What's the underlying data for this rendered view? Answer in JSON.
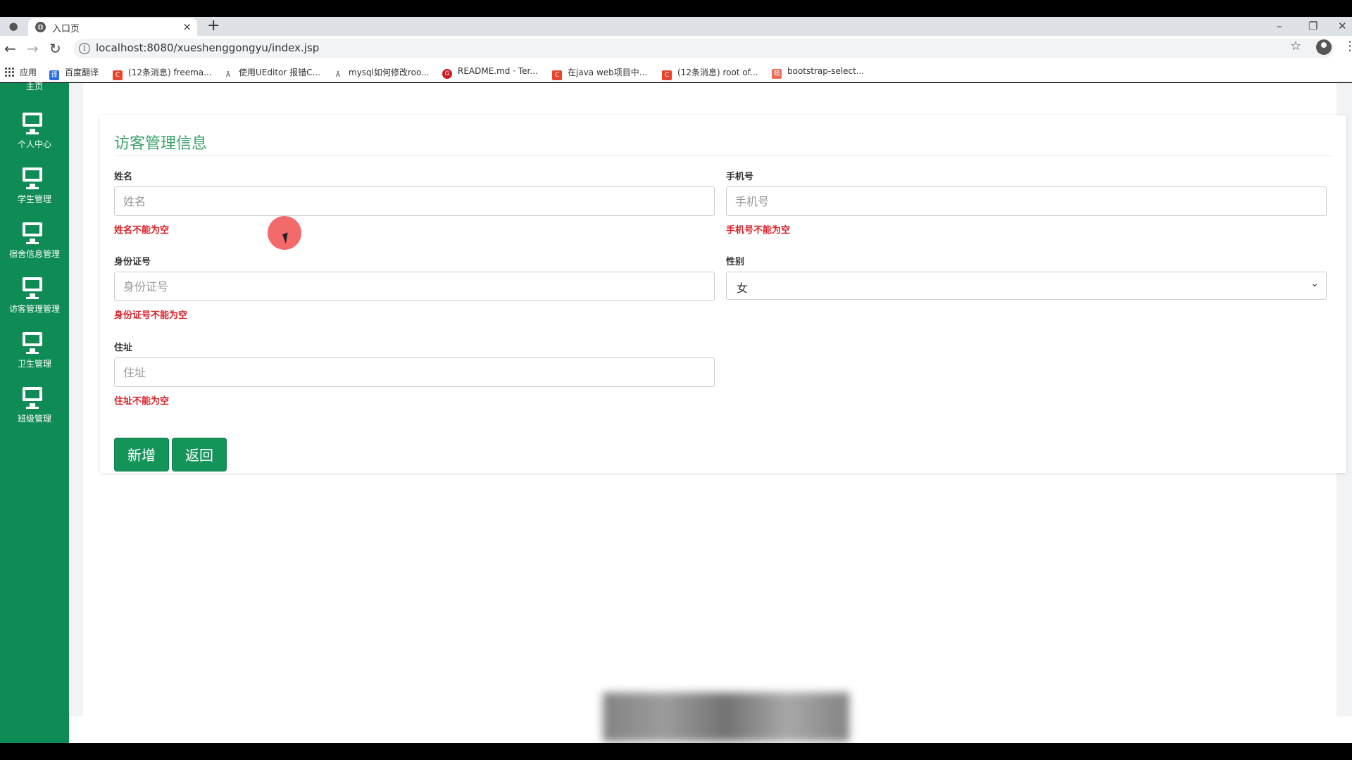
{
  "browser": {
    "tab_title": "入口页",
    "tab_close": "×",
    "new_tab": "+",
    "url": "localhost:8080/xueshenggongyu/index.jsp",
    "minimize": "–",
    "restore": "❐",
    "close": "✕"
  },
  "bookmarks": [
    {
      "label": "应用",
      "icon": "apps-grid"
    },
    {
      "label": "百度翻译",
      "icon": "translate",
      "color": "#2b6de5"
    },
    {
      "label": "(12条消息) freema...",
      "icon": "csdn",
      "color": "#e8452c"
    },
    {
      "label": "使用UEditor 报错C...",
      "icon": "a-icon"
    },
    {
      "label": "mysql如何修改roo...",
      "icon": "a-icon"
    },
    {
      "label": "README.md · Ter...",
      "icon": "gitee",
      "color": "#c71d23"
    },
    {
      "label": "在java web项目中...",
      "icon": "csdn",
      "color": "#e8452c"
    },
    {
      "label": "(12条消息) root of...",
      "icon": "csdn",
      "color": "#e8452c"
    },
    {
      "label": "bootstrap-select...",
      "icon": "jianshu",
      "color": "#ea6f5a"
    }
  ],
  "sidebar": {
    "partial_label": "主页",
    "items": [
      {
        "label": "个人中心"
      },
      {
        "label": "学生管理"
      },
      {
        "label": "宿舍信息管理"
      },
      {
        "label": "访客管理管理"
      },
      {
        "label": "卫生管理"
      },
      {
        "label": "班级管理"
      }
    ]
  },
  "form": {
    "title": "访客管理信息",
    "name_label": "姓名",
    "name_placeholder": "姓名",
    "name_error": "姓名不能为空",
    "phone_label": "手机号",
    "phone_placeholder": "手机号",
    "phone_error": "手机号不能为空",
    "id_label": "身份证号",
    "id_placeholder": "身份证号",
    "id_error": "身份证号不能为空",
    "gender_label": "性别",
    "gender_value": "女",
    "address_label": "住址",
    "address_placeholder": "住址",
    "address_error": "住址不能为空",
    "add_button": "新增",
    "back_button": "返回"
  },
  "colors": {
    "sidebar": "#0f8c55",
    "title": "#38a26a",
    "error": "#d9232a",
    "button": "#13955a"
  }
}
